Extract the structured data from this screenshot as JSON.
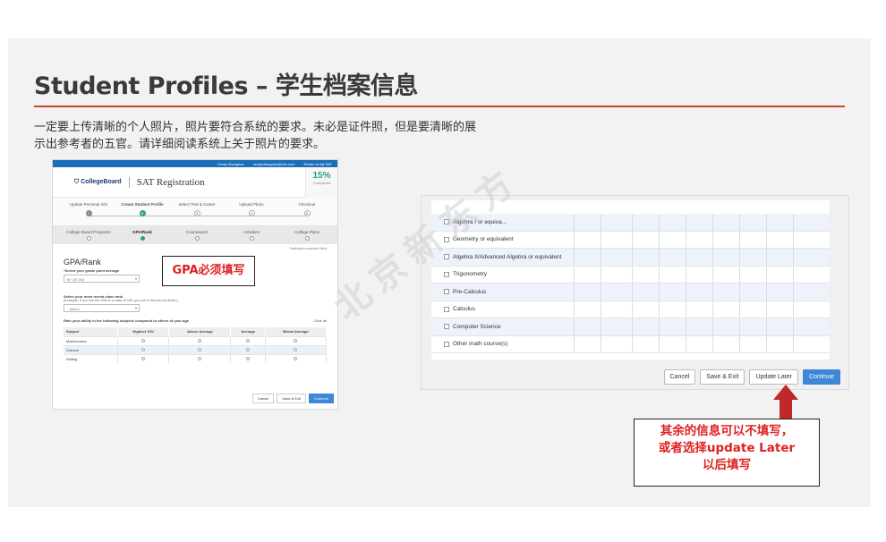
{
  "slide": {
    "title": "Student Profiles – 学生档案信息",
    "description": "一定要上传清晰的个人照片，照片要符合系统的要求。未必是证件照，但是要清晰的展示出参考者的五官。请详细阅读系统上关于照片的要求。",
    "accent_color": "#c8452c"
  },
  "left": {
    "topbar": {
      "user": "Cecily Zhanghan",
      "email": "cecilyzhanghan@abc.com",
      "link": "Return to My SAT"
    },
    "logo": "CollegeBoard",
    "app_title": "SAT Registration",
    "progress": {
      "value": "15%",
      "label": "Completed"
    },
    "steps": [
      {
        "label": "Update Personal Info",
        "num": "✓"
      },
      {
        "label": "Create Student Profile",
        "num": "2"
      },
      {
        "label": "Select Test & Center",
        "num": "3"
      },
      {
        "label": "Upload Photo",
        "num": "4"
      },
      {
        "label": "Checkout",
        "num": "5"
      }
    ],
    "subtabs": [
      "College Board Programs",
      "GPA/Rank",
      "Coursework",
      "Activities",
      "College Plans"
    ],
    "form": {
      "required_note": "*Indicates required field",
      "heading": "GPA/Rank",
      "gpa_label": "*Select your grade point average",
      "gpa_value": "B+ (87-89)",
      "rank_label": "Select your most recent class rank",
      "rank_example": "(Example: If you are the 15th in a class of 100, you are in the second tenth.)",
      "rank_value": "- Select -",
      "rate_label": "Rate your ability in the following subjects compared to others of your age",
      "clear_all": "Clear all",
      "columns": [
        "Subject",
        "Highest 10%",
        "Above Average",
        "Average",
        "Below Average"
      ],
      "rows": [
        "Mathematics",
        "Science",
        "Writing"
      ]
    },
    "buttons": {
      "cancel": "Cancel",
      "save": "Save & Exit",
      "continue": "Continue"
    },
    "note": "GPA必须填写"
  },
  "right": {
    "courses": [
      "Algebra I or equiva...",
      "Geometry or equivalent",
      "Algebra II/Advanced Algebra or equivalent",
      "Trigonometry",
      "Pre-Calculus",
      "Calculus",
      "Computer Science",
      "Other math course(s)"
    ],
    "buttons": {
      "cancel": "Cancel",
      "save": "Save & Exit",
      "update": "Update Later",
      "continue": "Continue"
    },
    "watermark": "北京新东方",
    "note_line1": "其余的信息可以不填写，",
    "note_line2": "或者选择update Later",
    "note_line3": "以后填写"
  }
}
